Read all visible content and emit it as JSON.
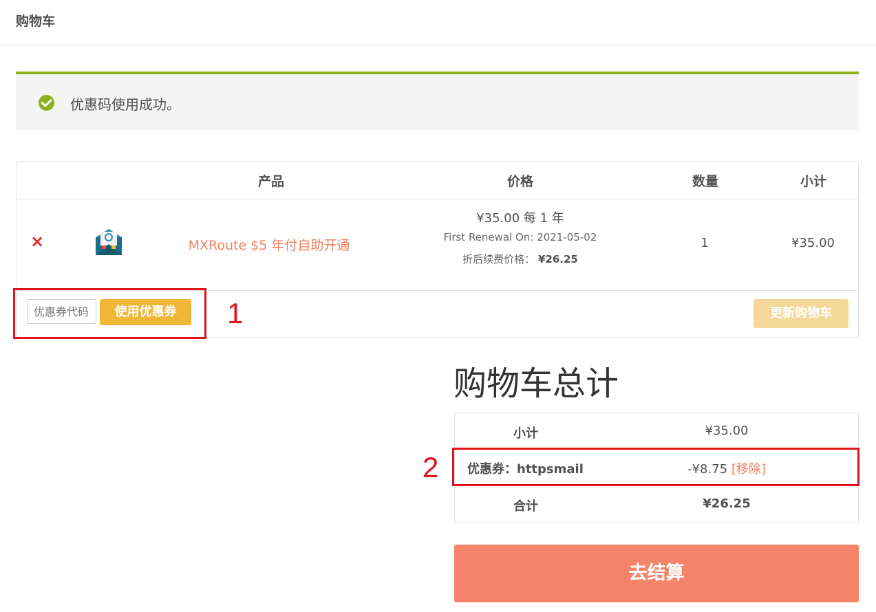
{
  "header": {
    "title": "购物车"
  },
  "notice": {
    "message": "优惠码使用成功。"
  },
  "cart": {
    "columns": [
      "产品",
      "价格",
      "数量",
      "小计"
    ],
    "item": {
      "remove_symbol": "×",
      "name": "MXRoute $5 年付自助开通",
      "price": "¥35.00 每 1 年",
      "first_renewal": "First Renewal On: 2021-05-02",
      "discount_label": "折后续费价格：",
      "discount_price": "¥26.25",
      "quantity": "1",
      "subtotal": "¥35.00"
    },
    "coupon_placeholder": "优惠券代码",
    "apply_coupon_label": "使用优惠券",
    "update_cart_label": "更新购物车"
  },
  "annotations": {
    "one": "1",
    "two": "2"
  },
  "totals": {
    "title": "购物车总计",
    "subtotal_label": "小计",
    "subtotal_value": "¥35.00",
    "coupon_label": "优惠券：httpsmail",
    "coupon_value": "-¥8.75",
    "coupon_remove": "[移除]",
    "total_label": "合计",
    "total_value": "¥26.25"
  },
  "checkout_label": "去结算",
  "icons": {
    "notice": "check-circle-icon",
    "remove": "close-icon",
    "product": "email-envelope-icon"
  },
  "colors": {
    "accent_green": "#8fae1b",
    "link_orange": "#f0815e",
    "button_yellow": "#efb638",
    "checkout": "#f4846a",
    "annotation_red": "#e0141a"
  }
}
